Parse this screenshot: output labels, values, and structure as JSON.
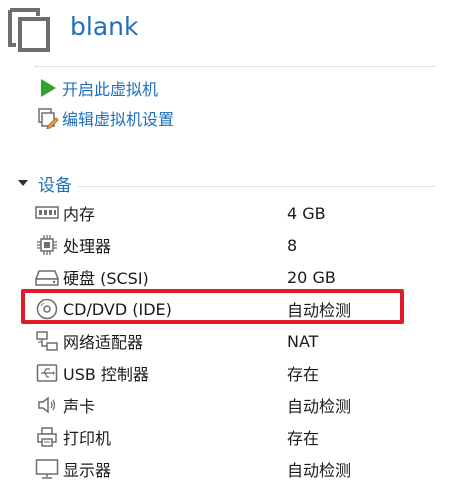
{
  "vm": {
    "title": "blank",
    "icon": "vm-window-icon"
  },
  "actions": [
    {
      "label": "开启此虚拟机",
      "icon": "play-icon",
      "color": "#2ea32e"
    },
    {
      "label": "编辑虚拟机设置",
      "icon": "edit-settings-icon"
    }
  ],
  "devices_section": {
    "label": "设备",
    "expanded": true,
    "items": [
      {
        "name": "内存",
        "value": "4 GB",
        "icon": "memory-icon"
      },
      {
        "name": "处理器",
        "value": "8",
        "icon": "processor-icon"
      },
      {
        "name": "硬盘 (SCSI)",
        "value": "20 GB",
        "icon": "hard-disk-icon"
      },
      {
        "name": "CD/DVD (IDE)",
        "value": "自动检测",
        "icon": "cd-dvd-icon",
        "highlighted": true
      },
      {
        "name": "网络适配器",
        "value": "NAT",
        "icon": "network-adapter-icon"
      },
      {
        "name": "USB 控制器",
        "value": "存在",
        "icon": "usb-icon"
      },
      {
        "name": "声卡",
        "value": "自动检测",
        "icon": "speaker-icon"
      },
      {
        "name": "打印机",
        "value": "存在",
        "icon": "printer-icon"
      },
      {
        "name": "显示器",
        "value": "自动检测",
        "icon": "display-icon"
      }
    ]
  },
  "colors": {
    "link": "#1f6fbf",
    "highlight_border": "#e01b2a"
  }
}
